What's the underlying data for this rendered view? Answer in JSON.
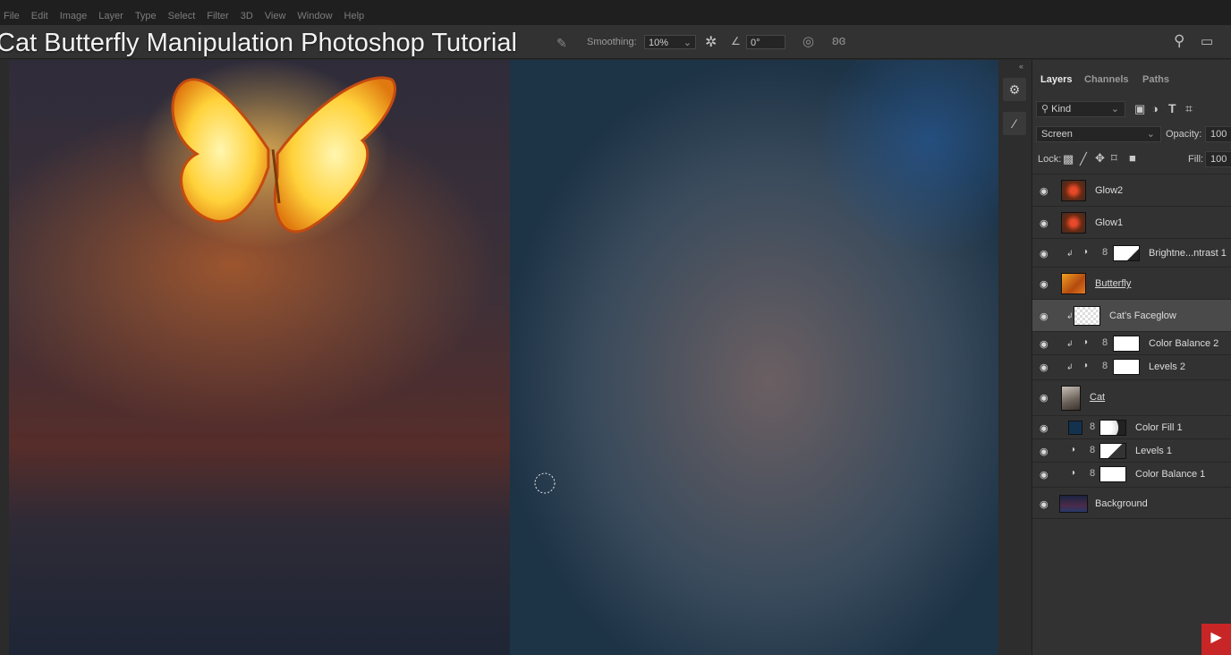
{
  "menu": [
    "File",
    "Edit",
    "Image",
    "Layer",
    "Type",
    "Select",
    "Filter",
    "3D",
    "View",
    "Window",
    "Help"
  ],
  "tutorial_title": "Cat Butterfly Manipulation Photoshop Tutorial",
  "options": {
    "smoothing_label": "Smoothing:",
    "smoothing_value": "10%",
    "angle_value": "0°"
  },
  "panel": {
    "tabs": [
      "Layers",
      "Channels",
      "Paths"
    ],
    "kind_label": "Kind",
    "blend_mode": "Screen",
    "opacity_label": "Opacity:",
    "opacity_value": "100",
    "lock_label": "Lock:",
    "fill_label": "Fill:",
    "fill_value": "100"
  },
  "layers": [
    {
      "name": "Glow2"
    },
    {
      "name": "Glow1"
    },
    {
      "name": "Brightne...ntrast 1"
    },
    {
      "name": "Butterfly"
    },
    {
      "name": "Cat's Faceglow"
    },
    {
      "name": "Color Balance 2"
    },
    {
      "name": "Levels 2"
    },
    {
      "name": "Cat"
    },
    {
      "name": "Color Fill 1"
    },
    {
      "name": "Levels 1"
    },
    {
      "name": "Color Balance 1"
    },
    {
      "name": "Background"
    }
  ],
  "icons": [
    "search-icon",
    "workspace-icon",
    "gear-icon",
    "angle-icon",
    "pressure-icon",
    "butterfly-symmetry-icon",
    "eye-icon",
    "adjustment-icon",
    "chain-icon",
    "clip-icon",
    "youtube-icon"
  ]
}
